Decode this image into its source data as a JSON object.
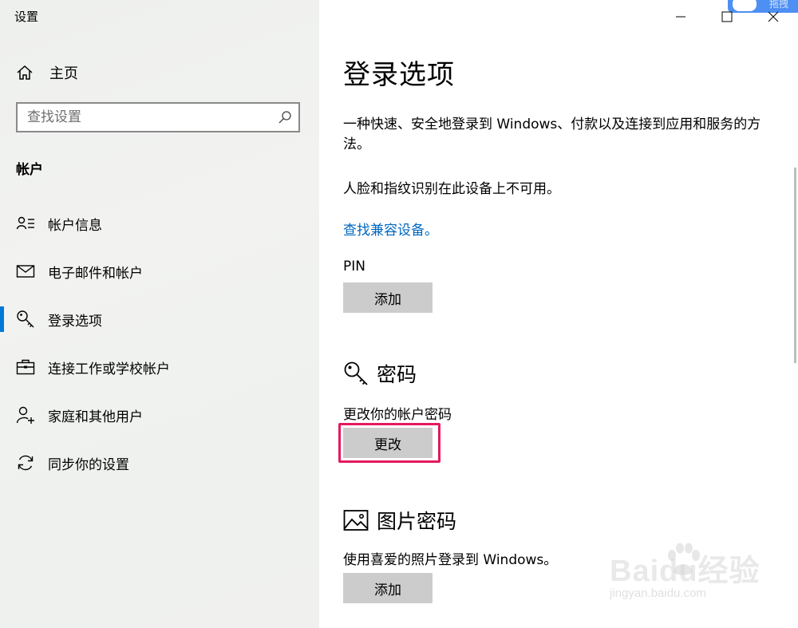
{
  "app": {
    "title": "设置"
  },
  "sidebar": {
    "home_label": "主页",
    "search_placeholder": "查找设置",
    "section_header": "帐户",
    "items": [
      {
        "label": "帐户信息",
        "icon": "account-info-icon"
      },
      {
        "label": "电子邮件和帐户",
        "icon": "mail-icon"
      },
      {
        "label": "登录选项",
        "icon": "key-icon",
        "active": true
      },
      {
        "label": "连接工作或学校帐户",
        "icon": "briefcase-icon"
      },
      {
        "label": "家庭和其他用户",
        "icon": "add-person-icon"
      },
      {
        "label": "同步你的设置",
        "icon": "sync-icon"
      }
    ]
  },
  "window_controls": [
    "minimize",
    "maximize",
    "close"
  ],
  "corner_badge": {
    "text": "拖拽"
  },
  "main": {
    "title": "登录选项",
    "description": "一种快速、安全地登录到 Windows、付款以及连接到应用和服务的方法。",
    "face_fingerprint_text": "人脸和指纹识别在此设备上不可用。",
    "compatible_link": "查找兼容设备。",
    "pin": {
      "label": "PIN",
      "button": "添加"
    },
    "password": {
      "title": "密码",
      "subtitle": "更改你的帐户密码",
      "button": "更改"
    },
    "picture_password": {
      "title": "图片密码",
      "subtitle": "使用喜爱的照片登录到 Windows。",
      "button": "添加"
    }
  },
  "watermark": {
    "main": "Baidu经验",
    "sub": "jingyan.baidu.com"
  },
  "colors": {
    "accent": "#0078d7",
    "link": "#0067c0",
    "highlight": "#e5195c",
    "button_bg": "#cccccc"
  }
}
